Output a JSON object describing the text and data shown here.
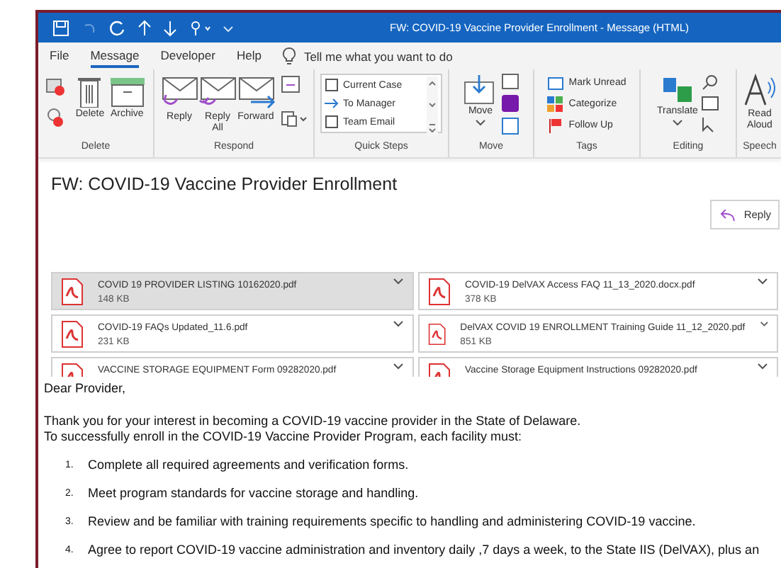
{
  "window": {
    "title": "FW: COVID-19 Vaccine Provider Enrollment  -  Message (HTML)"
  },
  "tabs": [
    {
      "label": "File",
      "selected": false
    },
    {
      "label": "Message",
      "selected": true
    },
    {
      "label": "Developer",
      "selected": false
    },
    {
      "label": "Help",
      "selected": false
    }
  ],
  "tell_me": {
    "placeholder": "Tell me what you want to do"
  },
  "ribbon": {
    "groups": [
      {
        "label": "Delete",
        "kind": "delete",
        "buttons": [
          "Delete",
          "Archive"
        ]
      },
      {
        "label": "Respond",
        "kind": "respond",
        "buttons": [
          "Reply",
          "Reply All",
          "Forward"
        ]
      },
      {
        "label": "Quick Steps",
        "kind": "quicksteps",
        "buttons": [
          "Current Case",
          "To Manager",
          "Team Email"
        ]
      },
      {
        "label": "Move",
        "kind": "move",
        "buttons": [
          "Move"
        ]
      },
      {
        "label": "Tags",
        "kind": "tags",
        "buttons": [
          "Mark Unread",
          "Categorize",
          "Follow Up"
        ]
      },
      {
        "label": "Editing",
        "kind": "editing",
        "buttons": [
          "Translate"
        ]
      },
      {
        "label": "Speech",
        "kind": "speech",
        "buttons": [
          "Read Aloud"
        ]
      }
    ]
  },
  "message": {
    "subject": "FW: COVID-19 Vaccine Provider Enrollment",
    "reply_button": "Reply",
    "attachments": [
      {
        "name": "COVID 19 PROVIDER LISTING 10162020.pdf",
        "size": "148 KB",
        "selected": true
      },
      {
        "name": "COVID-19 DelVAX Access FAQ 11_13_2020.docx.pdf",
        "size": "378 KB",
        "selected": false
      },
      {
        "name": "COVID-19 FAQs Updated_11.6.pdf",
        "size": "231 KB",
        "selected": false
      },
      {
        "name": "DelVAX COVID 19 ENROLLMENT Training Guide 11_12_2020.pdf",
        "size": "851 KB",
        "selected": false
      },
      {
        "name": "VACCINE STORAGE EQUIPMENT Form 09282020.pdf",
        "selected": false
      },
      {
        "name": "Vaccine Storage Equipment Instructions 09282020.pdf",
        "selected": false
      }
    ],
    "greeting": "Dear Provider,",
    "intro": [
      "Thank you for your interest in becoming a COVID-19 vaccine provider in the State of Delaware.",
      "To successfully enroll in the COVID-19 Vaccine Provider Program, each facility must:"
    ],
    "steps": [
      {
        "number": "1.",
        "text": "Complete all required agreements and verification forms."
      },
      {
        "number": "2.",
        "text": "Meet program standards for vaccine storage and handling."
      },
      {
        "number": "3.",
        "text": "Review and be familiar with training requirements specific to handling and administering COVID-19 vaccine."
      },
      {
        "number": "4.",
        "text": "Agree to report COVID-19 vaccine administration and inventory daily ,7 days a week, to the State IIS (DelVAX), plus an"
      }
    ]
  }
}
